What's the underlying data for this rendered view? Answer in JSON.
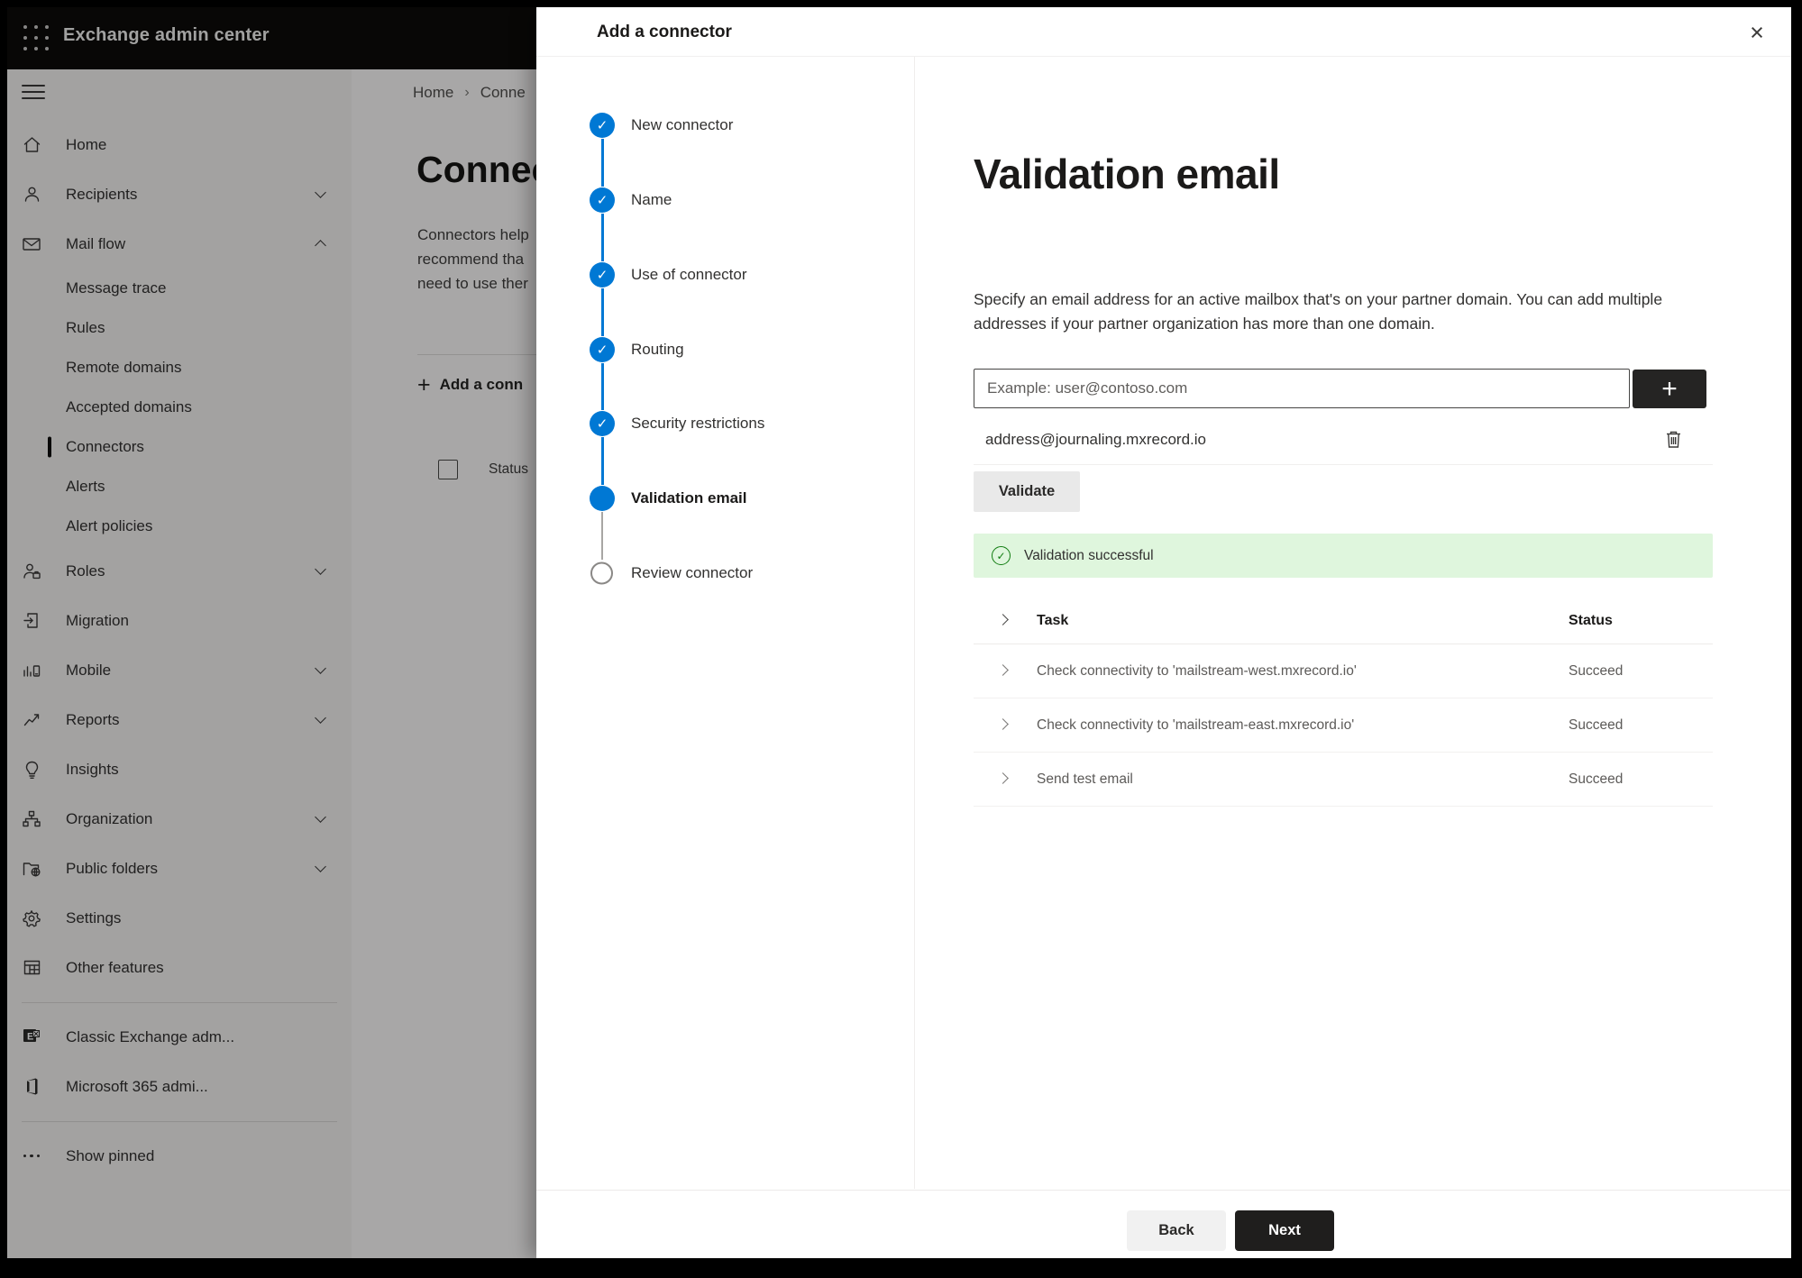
{
  "topbar": {
    "title": "Exchange admin center"
  },
  "sidebar": {
    "items": [
      {
        "type": "main",
        "icon": "home-icon",
        "label": "Home"
      },
      {
        "type": "main",
        "icon": "recipients-icon",
        "label": "Recipients",
        "chevron": "down"
      },
      {
        "type": "main",
        "icon": "mail-flow-icon",
        "label": "Mail flow",
        "chevron": "up"
      },
      {
        "type": "sub",
        "label": "Message trace"
      },
      {
        "type": "sub",
        "label": "Rules"
      },
      {
        "type": "sub",
        "label": "Remote domains"
      },
      {
        "type": "sub",
        "label": "Accepted domains"
      },
      {
        "type": "sub",
        "label": "Connectors",
        "selected": true
      },
      {
        "type": "sub",
        "label": "Alerts"
      },
      {
        "type": "sub",
        "label": "Alert policies"
      },
      {
        "type": "main",
        "icon": "roles-icon",
        "label": "Roles",
        "chevron": "down"
      },
      {
        "type": "main",
        "icon": "migration-icon",
        "label": "Migration"
      },
      {
        "type": "main",
        "icon": "mobile-icon",
        "label": "Mobile",
        "chevron": "down"
      },
      {
        "type": "main",
        "icon": "reports-icon",
        "label": "Reports",
        "chevron": "down"
      },
      {
        "type": "main",
        "icon": "insights-icon",
        "label": "Insights"
      },
      {
        "type": "main",
        "icon": "organization-icon",
        "label": "Organization",
        "chevron": "down"
      },
      {
        "type": "main",
        "icon": "public-folders-icon",
        "label": "Public folders",
        "chevron": "down"
      },
      {
        "type": "main",
        "icon": "settings-icon",
        "label": "Settings"
      },
      {
        "type": "main",
        "icon": "other-features-icon",
        "label": "Other features"
      },
      {
        "type": "divider"
      },
      {
        "type": "main",
        "icon": "classic-exchange-icon",
        "label": "Classic Exchange adm..."
      },
      {
        "type": "main",
        "icon": "microsoft-365-icon",
        "label": "Microsoft 365 admi..."
      },
      {
        "type": "divider"
      },
      {
        "type": "main",
        "icon": "more-dots-icon",
        "label": "Show pinned"
      }
    ]
  },
  "background_page": {
    "breadcrumb_home": "Home",
    "breadcrumb_separator": "›",
    "breadcrumb_current": "Conne",
    "heading": "Connec",
    "intro_line1": "Connectors help",
    "intro_line2": "recommend tha",
    "intro_line3": "need to use ther",
    "add_connector_label": "Add a conn",
    "add_connector_plus": "+",
    "list_header_status": "Status"
  },
  "panel": {
    "title": "Add a connector",
    "close_glyph": "×",
    "steps": [
      {
        "label": "New connector",
        "state": "complete"
      },
      {
        "label": "Name",
        "state": "complete"
      },
      {
        "label": "Use of connector",
        "state": "complete"
      },
      {
        "label": "Routing",
        "state": "complete"
      },
      {
        "label": "Security restrictions",
        "state": "complete"
      },
      {
        "label": "Validation email",
        "state": "current"
      },
      {
        "label": "Review connector",
        "state": "upcoming"
      }
    ],
    "check_glyph": "✓",
    "heading": "Validation email",
    "description": "Specify an email address for an active mailbox that's on your partner domain. You can add multiple addresses if your partner organization has more than one domain.",
    "email_input": {
      "value": "",
      "placeholder": "Example: user@contoso.com"
    },
    "add_address_glyph": "+",
    "added_address": "address@journaling.mxrecord.io",
    "validate_button": "Validate",
    "success_banner": "Validation successful",
    "table": {
      "task_header": "Task",
      "status_header": "Status",
      "rows": [
        {
          "task": "Check connectivity to 'mailstream-west.mxrecord.io'",
          "status": "Succeed"
        },
        {
          "task": "Check connectivity to 'mailstream-east.mxrecord.io'",
          "status": "Succeed"
        },
        {
          "task": "Send test email",
          "status": "Succeed"
        }
      ]
    },
    "back_button": "Back",
    "next_button": "Next"
  },
  "colors": {
    "accent_blue": "#0078d4",
    "success_green": "#107c10",
    "success_banner_bg": "#dff6dd",
    "topbar_bg": "#0c0b0a"
  }
}
